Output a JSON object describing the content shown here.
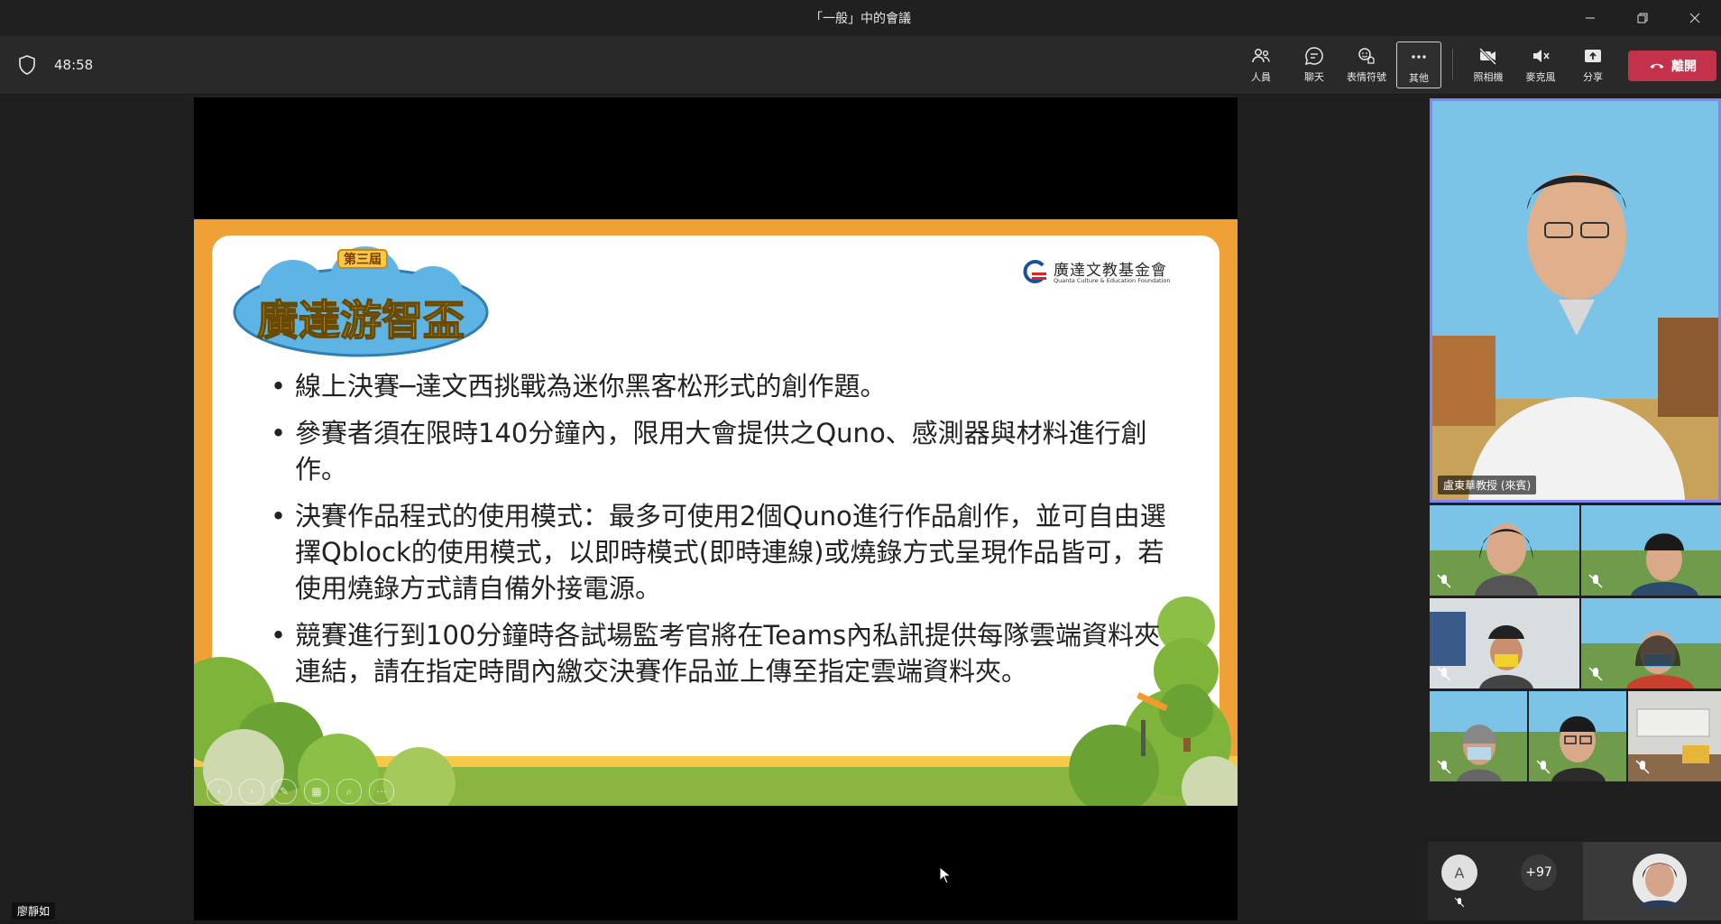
{
  "window": {
    "title": "「一般」中的會議"
  },
  "toolbar": {
    "timer": "48:58",
    "buttons": {
      "people": "人員",
      "chat": "聊天",
      "reactions": "表情符號",
      "more": "其他",
      "camera": "照相機",
      "mic": "麥克風",
      "share": "分享"
    },
    "leave_label": "離開"
  },
  "slide": {
    "foundation_name": "廣達文教基金會",
    "foundation_en": "Quanta Culture & Education Foundation",
    "bullets": [
      "線上決賽─達文西挑戰為迷你黑客松形式的創作題。",
      "參賽者須在限時140分鐘內，限用大會提供之Quno、感測器與材料進行創作。",
      "決賽作品程式的使用模式：最多可使用2個Quno進行作品創作，並可自由選擇Qblock的使用模式，以即時模式(即時連線)或燒錄方式呈現作品皆可，若使用燒錄方式請自備外接電源。",
      "競賽進行到100分鐘時各試場監考官將在Teams內私訊提供每隊雲端資料夾連結，請在指定時間內繳交決賽作品並上傳至指定雲端資料夾。"
    ]
  },
  "presenter_name": "廖靜如",
  "participants": {
    "main_speaker_name": "盧東華教授 (來賓)",
    "avatar_letter": "A",
    "more_count": "+97"
  },
  "colors": {
    "leave": "#c4314b",
    "speaker_border": "#7f85f5",
    "slide_orange": "#f0a135",
    "slide_green": "#8bb541"
  }
}
